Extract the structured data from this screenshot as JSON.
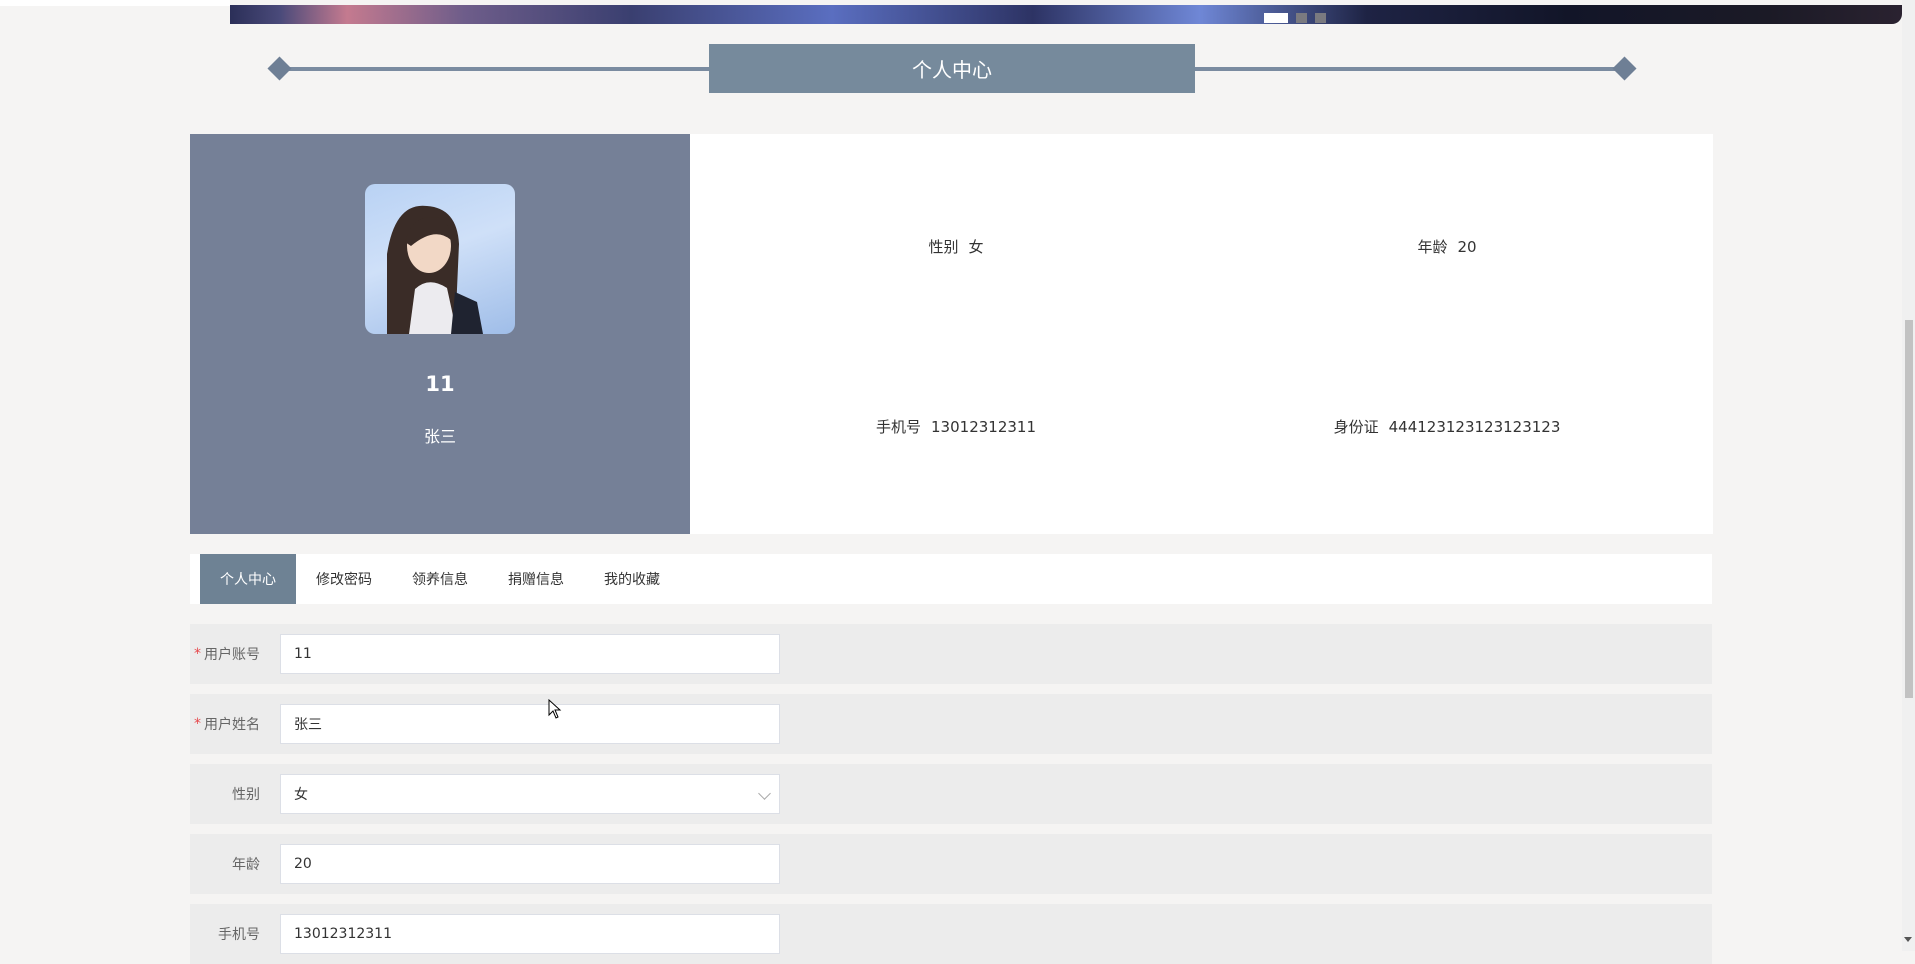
{
  "banner": {
    "slide_count": 3,
    "active_slide": 1
  },
  "page_title": "个人中心",
  "profile": {
    "account": "11",
    "name": "张三",
    "info": [
      {
        "label": "性别",
        "value": "女"
      },
      {
        "label": "年龄",
        "value": "20"
      },
      {
        "label": "手机号",
        "value": "13012312311"
      },
      {
        "label": "身份证",
        "value": "444123123123123123"
      }
    ]
  },
  "tabs": [
    {
      "label": "个人中心",
      "active": true
    },
    {
      "label": "修改密码",
      "active": false
    },
    {
      "label": "领养信息",
      "active": false
    },
    {
      "label": "捐赠信息",
      "active": false
    },
    {
      "label": "我的收藏",
      "active": false
    }
  ],
  "form": {
    "required_mark": "*",
    "fields": [
      {
        "label": "用户账号",
        "value": "11",
        "required": true,
        "type": "text"
      },
      {
        "label": "用户姓名",
        "value": "张三",
        "required": true,
        "type": "text"
      },
      {
        "label": "性别",
        "value": "女",
        "required": false,
        "type": "select"
      },
      {
        "label": "年龄",
        "value": "20",
        "required": false,
        "type": "text"
      },
      {
        "label": "手机号",
        "value": "13012312311",
        "required": false,
        "type": "text"
      }
    ]
  },
  "colors": {
    "profile_panel": "#758097",
    "title_box": "#768a9c",
    "active_tab": "#6e8294",
    "required_mark": "#e6464a"
  }
}
